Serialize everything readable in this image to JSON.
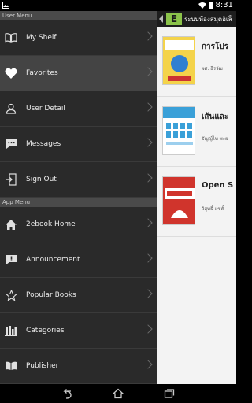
{
  "status_bar": {
    "time": "8:31"
  },
  "drawer": {
    "user_menu_header": "User Menu",
    "app_menu_header": "App Menu",
    "user_items": [
      {
        "label": "My Shelf",
        "icon": "book-open-icon"
      },
      {
        "label": "Favorites",
        "icon": "heart-icon"
      },
      {
        "label": "User Detail",
        "icon": "user-icon"
      },
      {
        "label": "Messages",
        "icon": "chat-icon"
      },
      {
        "label": "Sign Out",
        "icon": "sign-out-icon"
      }
    ],
    "app_items": [
      {
        "label": "2ebook Home",
        "icon": "home-icon"
      },
      {
        "label": "Announcement",
        "icon": "announcement-icon"
      },
      {
        "label": "Popular Books",
        "icon": "star-icon"
      },
      {
        "label": "Categories",
        "icon": "categories-icon"
      },
      {
        "label": "Publisher",
        "icon": "publisher-icon"
      }
    ],
    "active_item": "Favorites"
  },
  "app_bar": {
    "logo": "E",
    "title": "ระบบห้องสมุดอิเล็"
  },
  "books": [
    {
      "title": "การโปร",
      "author": "ผศ. ธีรวัฒ",
      "cover_color": "#f4d34a"
    },
    {
      "title": "เส้นและ",
      "author": "ธัญญ์ไท พะย",
      "cover_color": "#3aa0d8"
    },
    {
      "title": "Open S",
      "author": "วิสุทธิ์ แซ่ตั้",
      "cover_color": "#d0342c"
    }
  ],
  "colors": {
    "drawer_bg": "#2a2a2a",
    "active_bg": "#444444",
    "accent": "#8bc34a"
  }
}
